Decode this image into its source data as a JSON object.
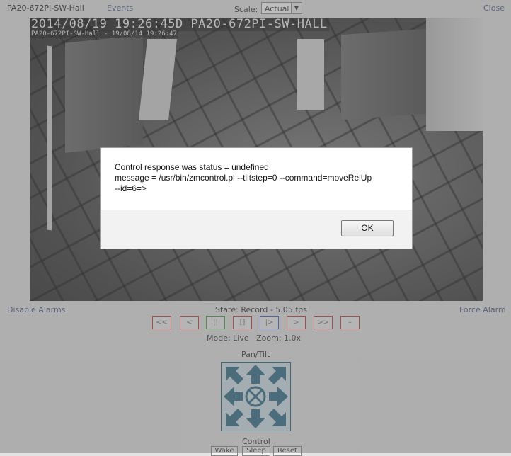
{
  "header": {
    "title": "PA20-672PI-SW-Hall",
    "events_link": "Events",
    "scale_label": "Scale:",
    "scale_value": "Actual",
    "close_link": "Close"
  },
  "feed": {
    "overlay_line1": "2014/08/19 19:26:45D PA20-672PI-SW-HALL",
    "overlay_line2": "PA20-672PI-SW-Hall - 19/08/14 19:26:47"
  },
  "status": {
    "disable_alarms": "Disable Alarms",
    "state": "State: Record - 5.05 fps",
    "force_alarm": "Force Alarm"
  },
  "playback": {
    "buttons": [
      {
        "label": "<<",
        "color": "#cc3333"
      },
      {
        "label": "<",
        "color": "#cc3333"
      },
      {
        "label": "||",
        "color": "#33aa33"
      },
      {
        "label": "[]",
        "color": "#cc3333"
      },
      {
        "label": "|>",
        "color": "#3355cc"
      },
      {
        "label": ">",
        "color": "#cc3333"
      },
      {
        "label": ">>",
        "color": "#cc3333"
      },
      {
        "label": "–",
        "color": "#cc3333"
      }
    ],
    "mode": "Mode: Live   Zoom: 1.0x"
  },
  "ptz": {
    "label": "Pan/Tilt",
    "control_label": "Control",
    "buttons": [
      "Wake",
      "Sleep",
      "Reset"
    ],
    "arrow_color": "#2f6a86"
  },
  "dialog": {
    "line1": "Control response was status = undefined",
    "line2": "message = /usr/bin/zmcontrol.pl --tiltstep=0 --command=moveRelUp",
    "line3": "--id=6=>",
    "ok_label": "OK"
  }
}
